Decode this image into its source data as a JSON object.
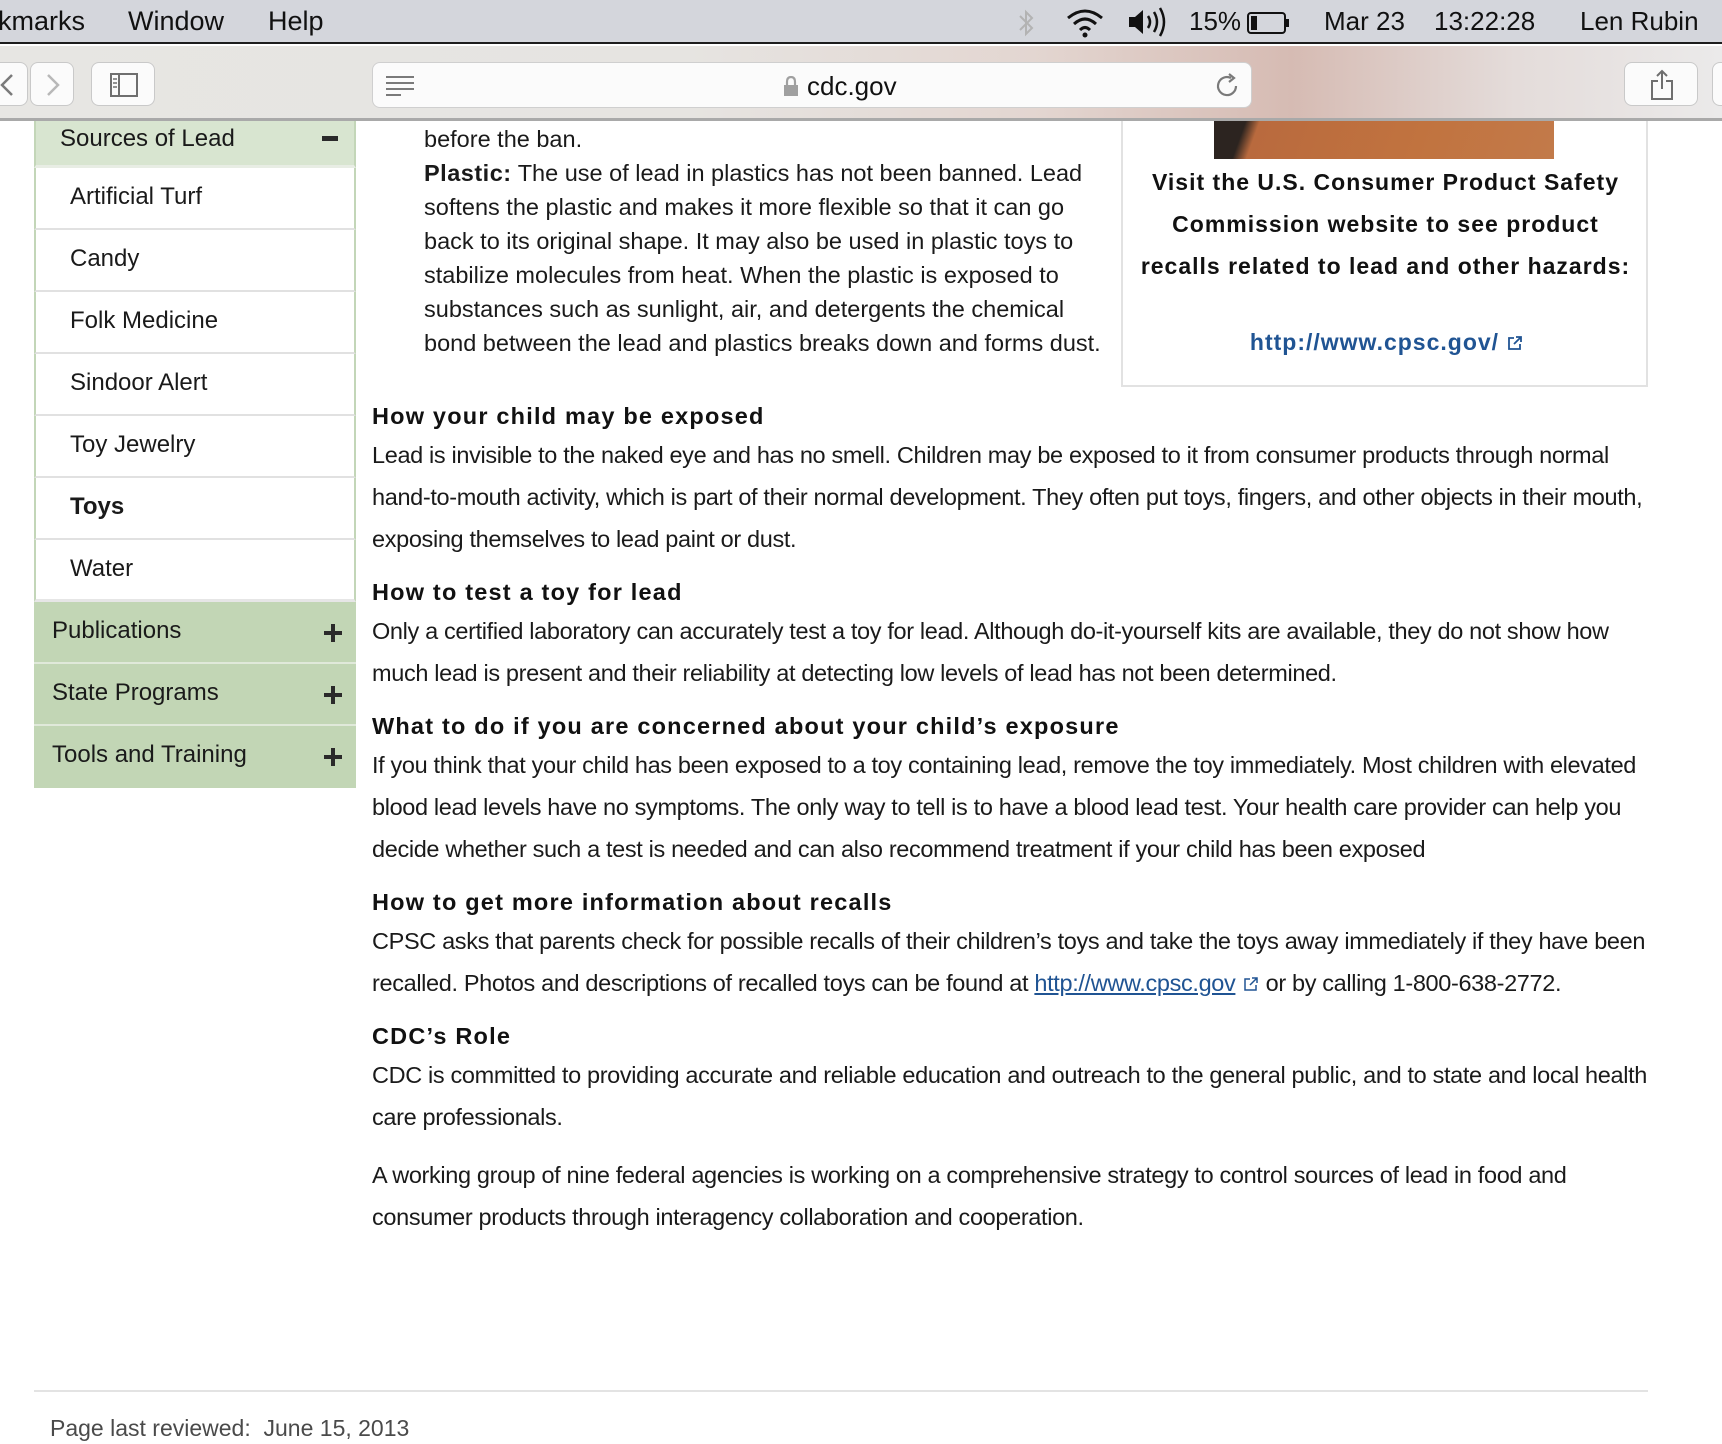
{
  "menubar": {
    "items": [
      "kmarks",
      "Window",
      "Help"
    ],
    "battery": "15%",
    "date": "Mar 23",
    "time": "13:22:28",
    "user": "Len Rubin",
    "icons": [
      "bluetooth-icon",
      "wifi-icon",
      "volume-icon",
      "battery-icon"
    ]
  },
  "browser": {
    "url": "cdc.gov",
    "icons": [
      "back-icon",
      "forward-icon",
      "sidebar-icon",
      "reader-icon",
      "lock-icon",
      "reload-icon",
      "share-icon"
    ]
  },
  "sidebar": {
    "section": {
      "label": "Sources of Lead",
      "state": "expanded"
    },
    "subitems": [
      {
        "label": "Artificial Turf",
        "active": false
      },
      {
        "label": "Candy",
        "active": false
      },
      {
        "label": "Folk Medicine",
        "active": false
      },
      {
        "label": "Sindoor Alert",
        "active": false
      },
      {
        "label": "Toy Jewelry",
        "active": false
      },
      {
        "label": "Toys",
        "active": true
      },
      {
        "label": "Water",
        "active": false
      }
    ],
    "topitems": [
      {
        "label": "Publications",
        "state": "collapsed"
      },
      {
        "label": "State Programs",
        "state": "collapsed"
      },
      {
        "label": "Tools and Training",
        "state": "collapsed"
      }
    ]
  },
  "content": {
    "top_fragment": "before the ban.",
    "plastic_label": "Plastic:",
    "plastic_text": " The use of lead in plastics has not been banned. Lead softens the plastic and makes it more flexible so that it can go back to its original shape. It may also be used in plastic toys to stabilize molecules from heat. When the plastic is exposed to substances such as sunlight, air, and detergents the chemical bond between the lead and plastics breaks down and forms dust.",
    "sections": [
      {
        "heading": "How your child may be exposed",
        "paragraphs": [
          "Lead is invisible to the naked eye and has no smell. Children may be exposed to it from consumer products through normal hand-to-mouth activity, which is part of their normal development. They often put toys, fingers, and other objects in their mouth, exposing themselves to lead paint or dust."
        ]
      },
      {
        "heading": "How to test a toy for lead",
        "paragraphs": [
          "Only a certified laboratory can accurately test a toy for lead. Although do-it-yourself kits are available, they do not show how much lead is present and their reliability at detecting low levels of lead has not been determined."
        ]
      },
      {
        "heading": "What to do if you are concerned about your child’s exposure",
        "paragraphs": [
          "If you think that your child has been exposed to a toy containing lead, remove the toy immediately. Most children with elevated blood lead levels have no symptoms. The only way to tell is to have a blood lead test. Your health care provider can help you decide whether such a test is needed and can also recommend treatment if your child has been exposed"
        ]
      },
      {
        "heading": "How to get more information about recalls",
        "recall_before": "CPSC asks that parents check for possible recalls of their children’s toys and take the toys away immediately if they have been recalled. Photos and descriptions of recalled toys can be found at ",
        "recall_link": "http://www.cpsc.gov",
        "recall_after": " or by calling 1-800-638-2772."
      },
      {
        "heading": "CDC’s Role",
        "paragraphs": [
          "CDC is committed to providing accurate and reliable education and outreach to the general public, and to state and local health care professionals.",
          "A working group of nine federal agencies is working on a comprehensive strategy to control sources of lead in food and consumer products through interagency collaboration and cooperation."
        ]
      }
    ]
  },
  "cpsc_box": {
    "text": "Visit the U.S. Consumer Product Safety Commission website to see product recalls related to lead and other hazards:",
    "link": "http://www.cpsc.gov/"
  },
  "footer": {
    "label": "Page last reviewed:",
    "date": "June 15, 2013"
  },
  "colors": {
    "nav_section_bg": "#d8e5d0",
    "nav_top_bg": "#c2d6b5",
    "link": "#205493"
  }
}
